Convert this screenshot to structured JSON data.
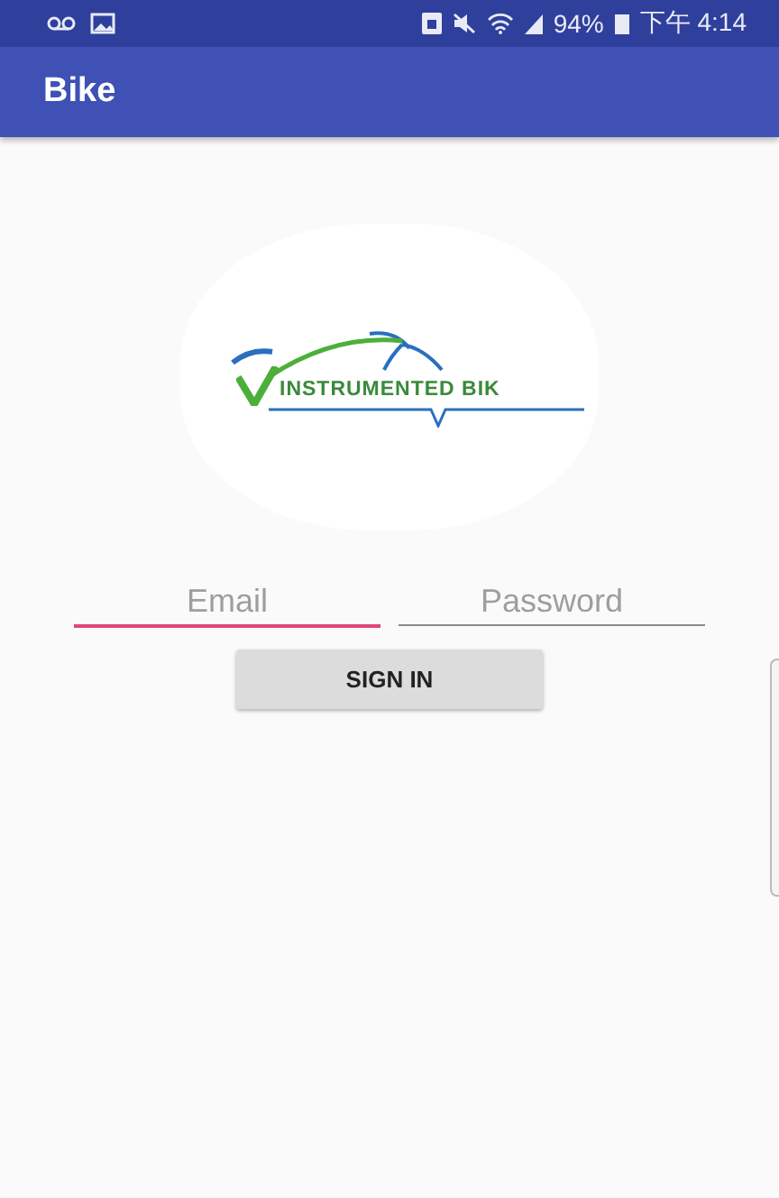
{
  "status_bar": {
    "battery": "94%",
    "time": "下午 4:14"
  },
  "app_bar": {
    "title": "Bike"
  },
  "logo": {
    "text": "INSTRUMENTED BIK"
  },
  "fields": [
    {
      "placeholder": "Email",
      "focused": true
    },
    {
      "placeholder": "Password",
      "focused": false
    }
  ],
  "button": {
    "label": "SIGN IN"
  }
}
